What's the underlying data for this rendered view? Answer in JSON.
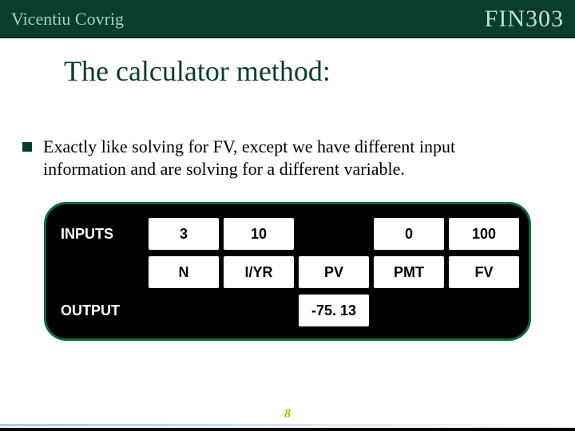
{
  "header": {
    "author": "Vicentiu Covrig",
    "course": "FIN303"
  },
  "title": "The calculator method:",
  "bullet": "Exactly like solving for FV, except we have different input information and are solving for a different variable.",
  "calc": {
    "rowLabels": {
      "inputs": "INPUTS",
      "output": "OUTPUT"
    },
    "cols": [
      "N",
      "I/YR",
      "PV",
      "PMT",
      "FV"
    ],
    "inputs": {
      "N": "3",
      "IYR": "10",
      "PV": "",
      "PMT": "0",
      "FV": "100"
    },
    "output": {
      "PV": "-75. 13"
    }
  },
  "page": "8"
}
